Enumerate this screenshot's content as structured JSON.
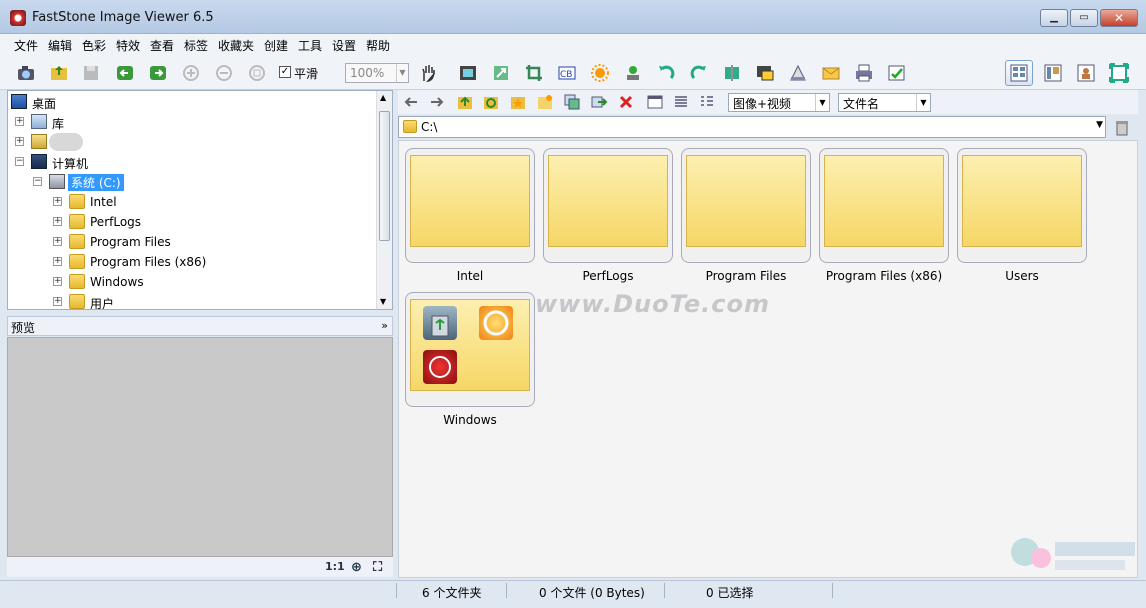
{
  "window": {
    "title": "FastStone Image Viewer 6.5"
  },
  "menu": [
    "文件",
    "编辑",
    "色彩",
    "特效",
    "查看",
    "标签",
    "收藏夹",
    "创建",
    "工具",
    "设置",
    "帮助"
  ],
  "toolbar": {
    "smooth_label": "平滑",
    "smooth_checked": "✓",
    "zoom_value": "100%"
  },
  "tree": {
    "desktop": "桌面",
    "library": "库",
    "computer": "计算机",
    "system_drive": "系统 (C:)",
    "folders": [
      "Intel",
      "PerfLogs",
      "Program Files",
      "Program Files (x86)",
      "Windows",
      "用户"
    ]
  },
  "preview": {
    "title": "预览",
    "ratio_label": "1:1"
  },
  "nav": {
    "view_mode": "图像+视频",
    "sort_by": "文件名",
    "path": "C:\\"
  },
  "thumbnails": [
    {
      "label": "Intel"
    },
    {
      "label": "PerfLogs"
    },
    {
      "label": "Program Files"
    },
    {
      "label": "Program Files (x86)"
    },
    {
      "label": "Users"
    },
    {
      "label": "Windows"
    }
  ],
  "watermark": "www.DuoTe.com",
  "status": {
    "folders": "6 个文件夹",
    "files": "0 个文件 (0 Bytes)",
    "selected": "0 已选择"
  },
  "colors": {
    "selection": "#3399ff",
    "folder_thumb": "#f6d766"
  }
}
